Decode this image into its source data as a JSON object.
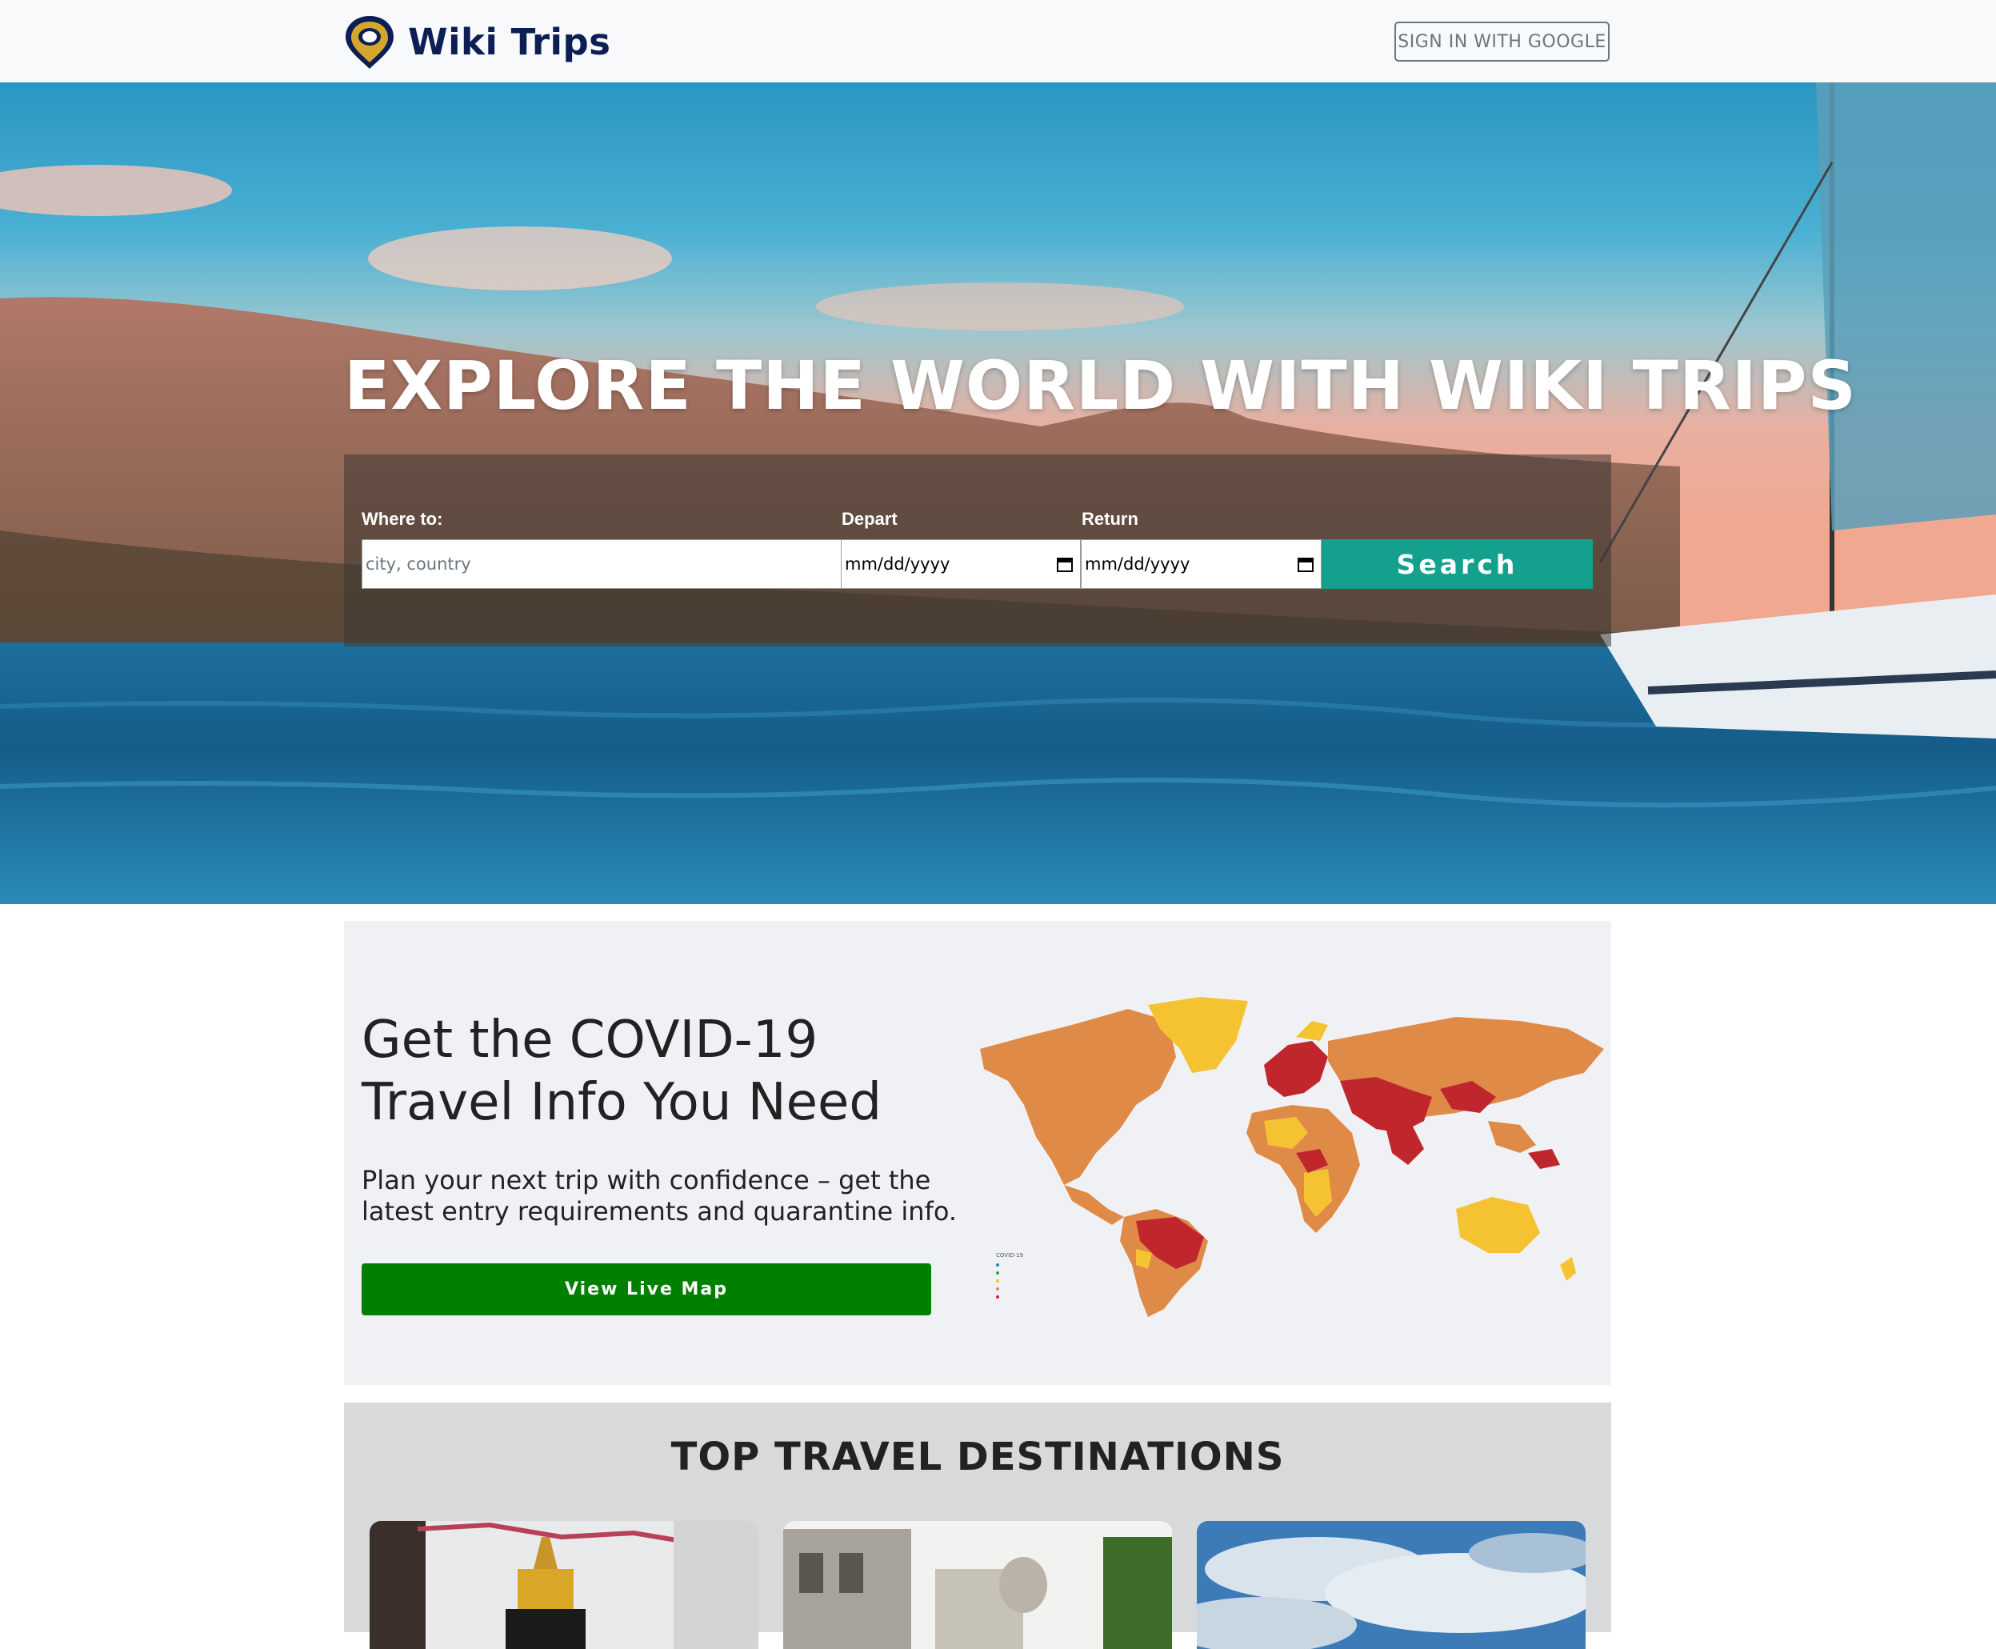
{
  "navbar": {
    "brand": "Wiki Trips",
    "logo_icon": "map-pin-icon",
    "signin_label": "SIGN IN WITH GOOGLE"
  },
  "hero": {
    "title": "EXPLORE THE WORLD WITH WIKI TRIPS",
    "where_label": "Where to:",
    "where_placeholder": "city, country",
    "depart_label": "Depart",
    "depart_value": "mm/dd/yyyy",
    "return_label": "Return",
    "return_value": "mm/dd/yyyy",
    "search_label": "Search"
  },
  "covid": {
    "title": "Get the COVID-19 Travel Info You Need",
    "text": "Plan your next trip with confidence – get the latest entry requirements and quarantine info.",
    "button_label": "View Live Map"
  },
  "destinations": {
    "title": "TOP TRAVEL DESTINATIONS"
  },
  "colors": {
    "brand": "#0d1e54",
    "search_button": "#13a08c",
    "map_button": "#008000"
  }
}
